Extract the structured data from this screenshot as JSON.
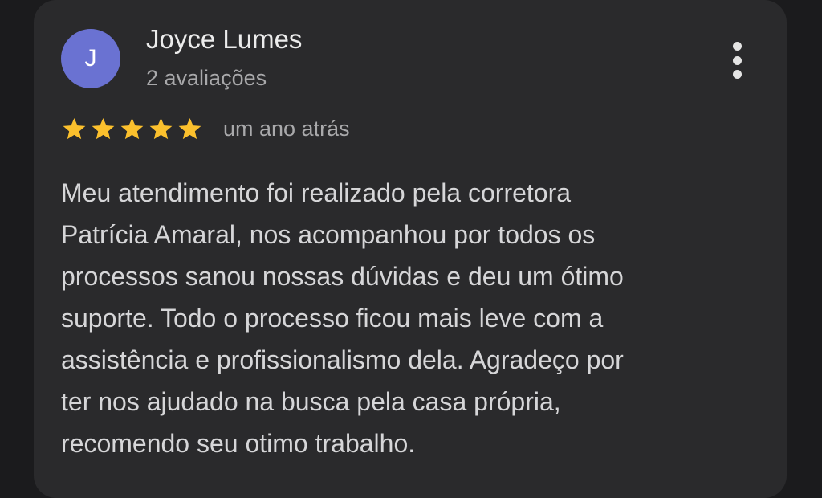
{
  "review": {
    "avatar_initial": "J",
    "author_name": "Joyce Lumes",
    "review_count": "2 avaliações",
    "rating": 5,
    "rating_max": 5,
    "time_ago": "um ano atrás",
    "text_lines": [
      "Meu atendimento foi realizado pela corretora",
      "Patrícia Amaral, nos acompanhou por todos os",
      "processos sanou nossas dúvidas e deu um ótimo",
      "suporte. Todo o processo ficou mais leve com a",
      "assistência e profissionalismo dela. Agradeço por",
      "ter nos ajudado na busca pela casa própria,",
      "recomendo seu otimo trabalho."
    ]
  },
  "icons": {
    "menu": "more-vert-icon",
    "star": "star-icon"
  },
  "colors": {
    "background": "#1b1b1d",
    "card": "#2a2a2c",
    "avatar": "#6a72d2",
    "star": "#fbc02d",
    "name_text": "#ececec",
    "secondary_text": "#a9a9ab",
    "body_text": "#d6d6d8"
  }
}
